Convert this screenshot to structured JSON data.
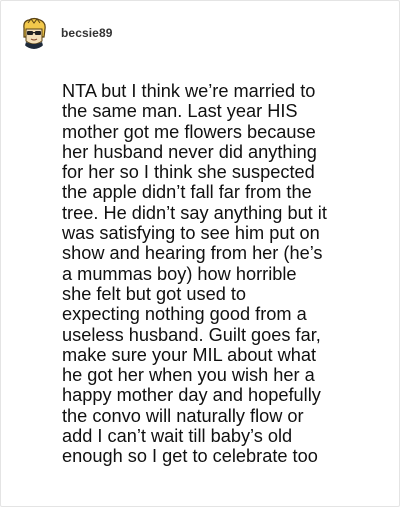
{
  "post": {
    "username": "becsie89",
    "avatar_icon": "cartoon-face-avatar",
    "comment_text": "NTA but I think we’re married to\nthe same man. Last year HIS\nmother got me flowers because\nher husband never did anything\nfor her so I think she suspected\nthe apple didn’t fall far from the\ntree. He didn’t say anything but it\nwas satisfying to see him put on\nshow and hearing from her (he’s\na mummas boy) how horrible\nshe felt but got used to\nexpecting nothing good from a\nuseless husband. Guilt goes far,\nmake sure your MIL about what\nhe got her when you wish her a\nhappy mother day and hopefully\nthe convo will naturally flow or\nadd I can’t wait till baby’s old\nenough so I get to celebrate too"
  },
  "colors": {
    "background": "#ffffff",
    "border": "#e4e4e4",
    "username": "#333333",
    "text": "#111111",
    "avatar_yellow": "#f2c84b"
  }
}
